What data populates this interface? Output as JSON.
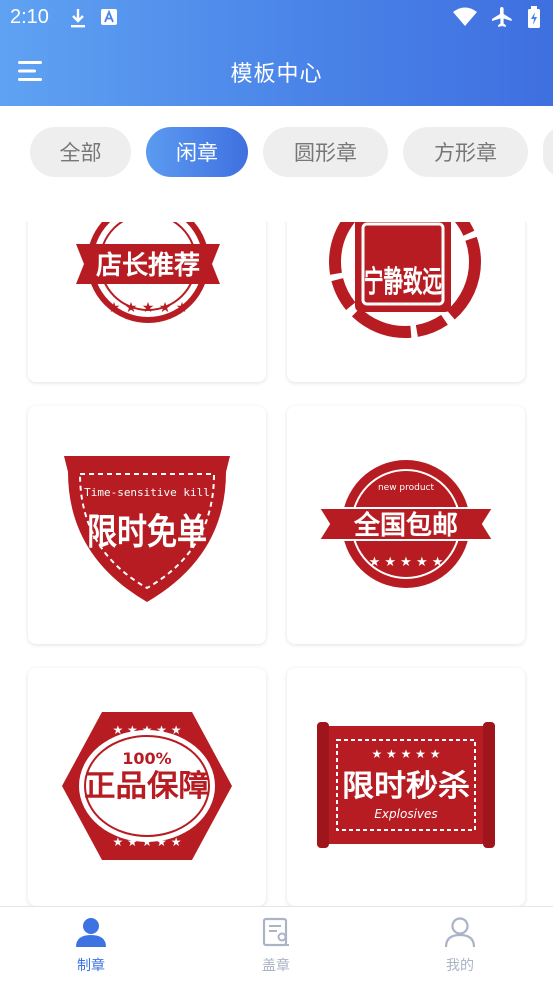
{
  "status_bar": {
    "time": "2:10"
  },
  "app_bar": {
    "title": "模板中心"
  },
  "tabs": [
    {
      "label": "全部",
      "active": false
    },
    {
      "label": "闲章",
      "active": true
    },
    {
      "label": "圆形章",
      "active": false
    },
    {
      "label": "方形章",
      "active": false
    }
  ],
  "stamps": [
    {
      "text": "店长推荐",
      "shape": "round-banner"
    },
    {
      "text": "宁静致远",
      "shape": "square-brush"
    },
    {
      "text": "限时免单",
      "subtext": "Time-sensitive kill",
      "shape": "shield"
    },
    {
      "text": "全国包邮",
      "subtext": "new product",
      "shape": "scalloped-banner"
    },
    {
      "text": "正品保障",
      "subtext": "100%",
      "shape": "hexagon"
    },
    {
      "text": "限时秒杀",
      "subtext": "Explosives",
      "shape": "scroll"
    }
  ],
  "bottom_nav": [
    {
      "label": "制章",
      "icon": "person-icon",
      "active": true
    },
    {
      "label": "盖章",
      "icon": "stamp-document-icon",
      "active": false
    },
    {
      "label": "我的",
      "icon": "profile-icon",
      "active": false
    }
  ],
  "colors": {
    "accent": "#3f70e0",
    "stamp_red": "#b71c22",
    "tab_bg": "#eeeeee"
  }
}
